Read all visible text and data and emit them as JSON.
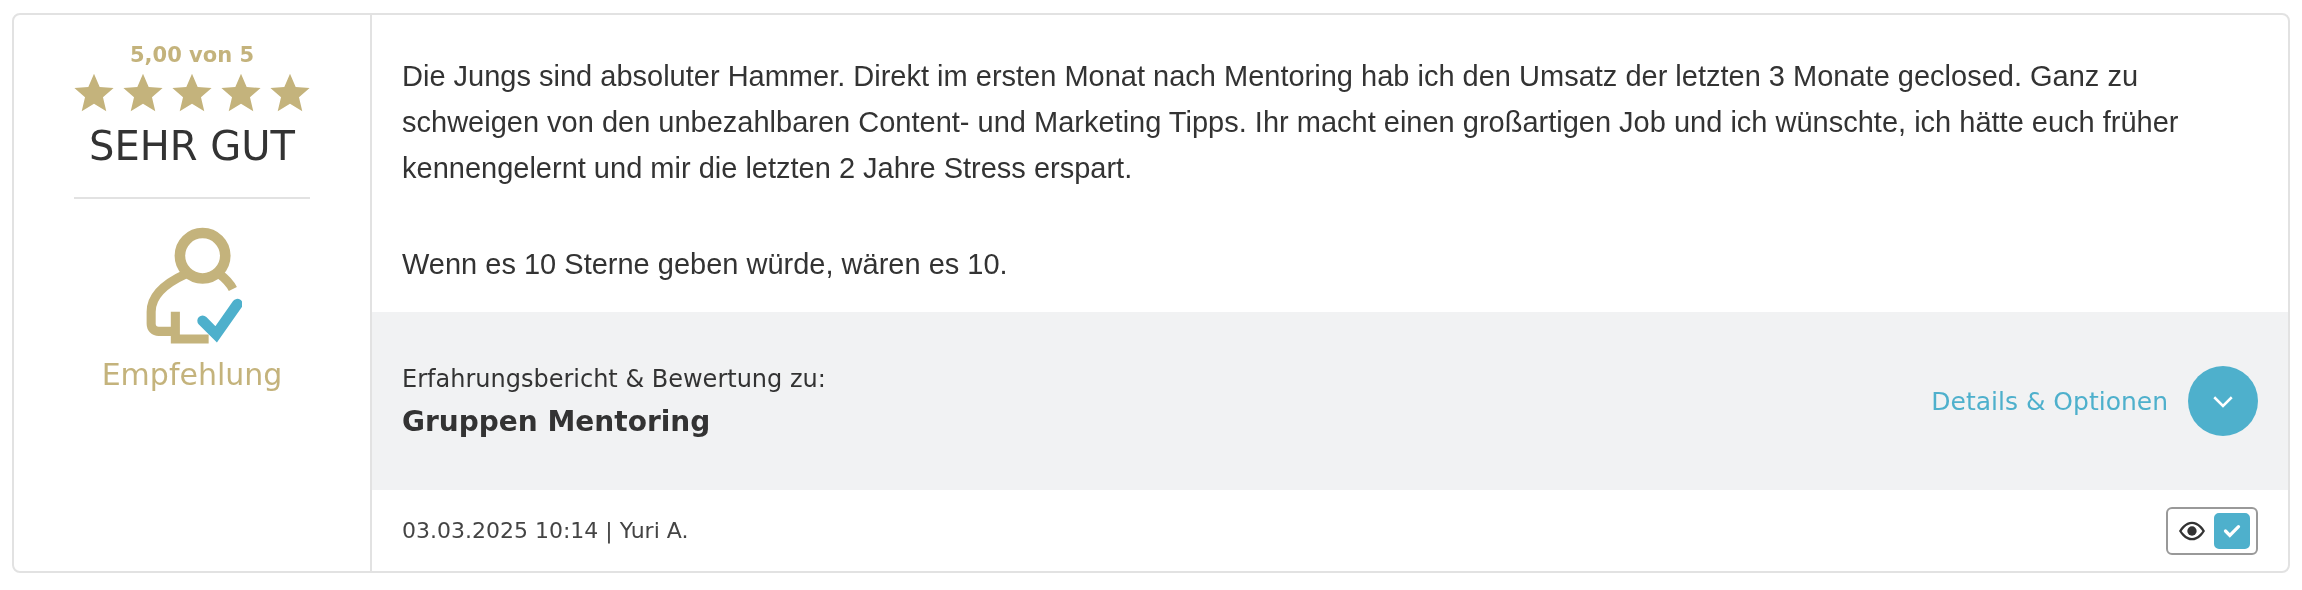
{
  "rating": {
    "score": "5,00 von 5",
    "stars": 5,
    "verdict": "SEHR GUT",
    "recommendation": "Empfehlung"
  },
  "review": {
    "paragraphs": [
      "Die Jungs sind absoluter Hammer. Direkt im ersten Monat nach Mentoring hab ich den Umsatz der letzten 3 Monate geclosed. Ganz zu schweigen von den unbezahlbaren Content- und Marketing Tipps. Ihr macht einen großartigen Job und ich wünschte, ich hätte euch früher kennengelernt und mir die letzten 2 Jahre Stress erspart.",
      "Wenn es 10 Sterne geben würde, wären es 10."
    ]
  },
  "product": {
    "label": "Erfahrungsbericht & Bewertung zu:",
    "name": "Gruppen Mentoring",
    "details_link": "Details & Optionen",
    "expanded": false
  },
  "footer": {
    "meta": "03.03.2025 10:14 | Yuri A.",
    "verified": true
  }
}
